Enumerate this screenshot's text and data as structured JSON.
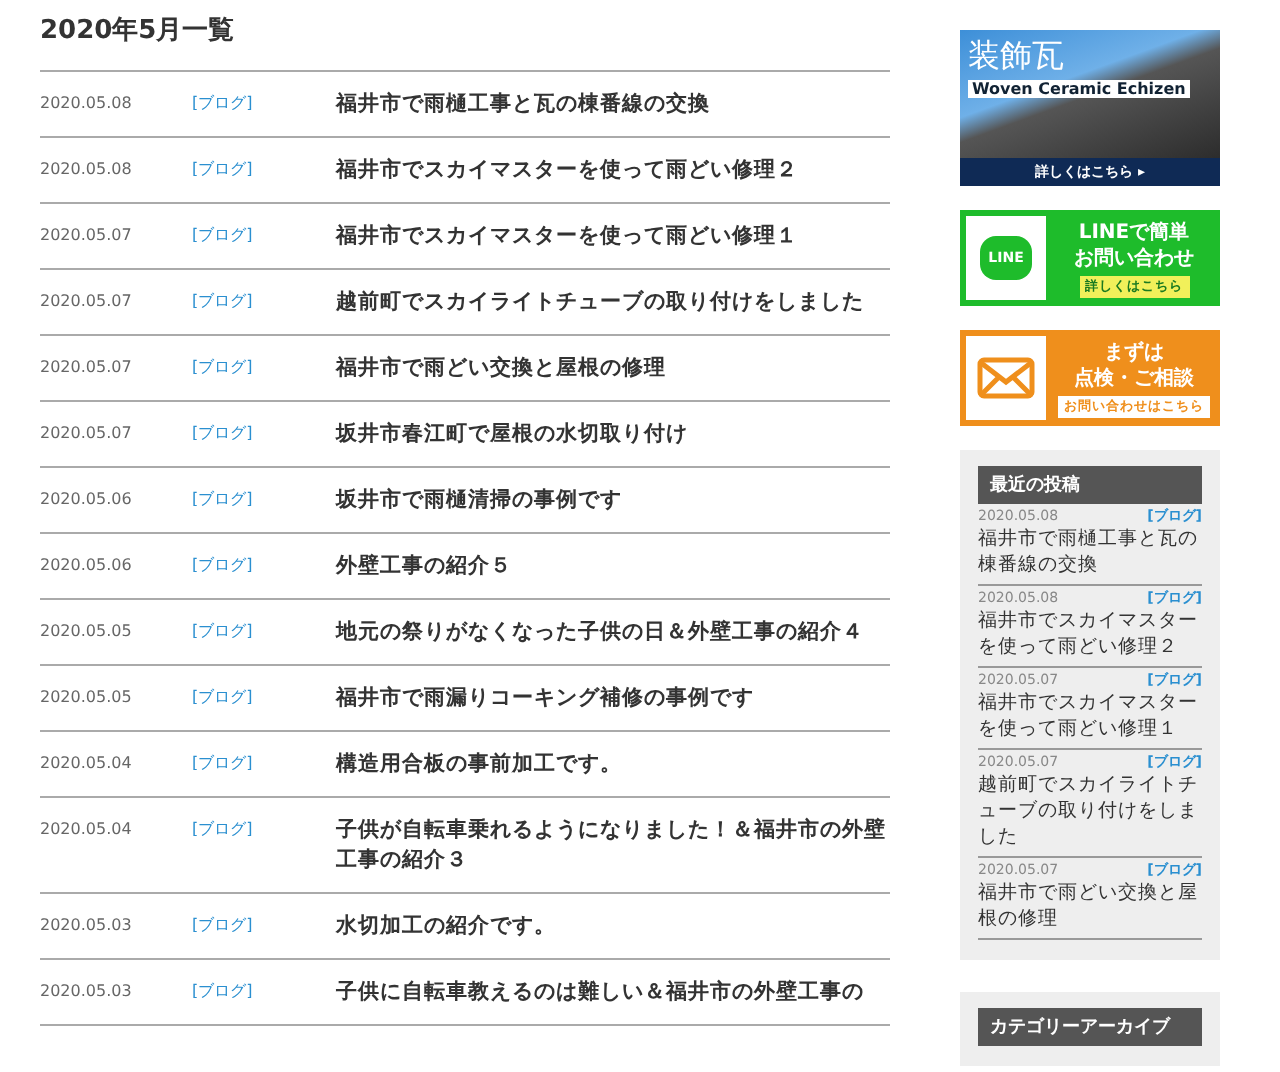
{
  "heading": "2020年5月一覧",
  "posts": [
    {
      "date": "2020.05.08",
      "category": "[ブログ]",
      "title": "福井市で雨樋工事と瓦の棟番線の交換"
    },
    {
      "date": "2020.05.08",
      "category": "[ブログ]",
      "title": "福井市でスカイマスターを使って雨どい修理２"
    },
    {
      "date": "2020.05.07",
      "category": "[ブログ]",
      "title": "福井市でスカイマスターを使って雨どい修理１"
    },
    {
      "date": "2020.05.07",
      "category": "[ブログ]",
      "title": "越前町でスカイライトチューブの取り付けをしました"
    },
    {
      "date": "2020.05.07",
      "category": "[ブログ]",
      "title": "福井市で雨どい交換と屋根の修理"
    },
    {
      "date": "2020.05.07",
      "category": "[ブログ]",
      "title": "坂井市春江町で屋根の水切取り付け"
    },
    {
      "date": "2020.05.06",
      "category": "[ブログ]",
      "title": "坂井市で雨樋清掃の事例です"
    },
    {
      "date": "2020.05.06",
      "category": "[ブログ]",
      "title": "外壁工事の紹介５"
    },
    {
      "date": "2020.05.05",
      "category": "[ブログ]",
      "title": "地元の祭りがなくなった子供の日＆外壁工事の紹介４"
    },
    {
      "date": "2020.05.05",
      "category": "[ブログ]",
      "title": "福井市で雨漏りコーキング補修の事例です"
    },
    {
      "date": "2020.05.04",
      "category": "[ブログ]",
      "title": "構造用合板の事前加工です。"
    },
    {
      "date": "2020.05.04",
      "category": "[ブログ]",
      "title": "子供が自転車乗れるようになりました！＆福井市の外壁工事の紹介３"
    },
    {
      "date": "2020.05.03",
      "category": "[ブログ]",
      "title": "水切加工の紹介です。"
    },
    {
      "date": "2020.05.03",
      "category": "[ブログ]",
      "title": "子供に自転車教えるのは難しい＆福井市の外壁工事の"
    }
  ],
  "sidebar": {
    "tile_banner": {
      "title": "装飾瓦",
      "subtitle": "Woven Ceramic Echizen",
      "link": "詳しくはこちら ▸"
    },
    "line_banner": {
      "icon_text": "LINE",
      "line_1": "LINEで簡単",
      "line_2": "お問い合わせ",
      "link": "詳しくはこちら"
    },
    "mail_banner": {
      "line_1": "まずは",
      "line_2": "点検・ご相談",
      "link": "お問い合わせはこちら"
    },
    "recent_posts": {
      "title": "最近の投稿",
      "items": [
        {
          "date": "2020.05.08",
          "category": "[ブログ]",
          "title": "福井市で雨樋工事と瓦の棟番線の交換"
        },
        {
          "date": "2020.05.08",
          "category": "[ブログ]",
          "title": "福井市でスカイマスターを使って雨どい修理２"
        },
        {
          "date": "2020.05.07",
          "category": "[ブログ]",
          "title": "福井市でスカイマスターを使って雨どい修理１"
        },
        {
          "date": "2020.05.07",
          "category": "[ブログ]",
          "title": "越前町でスカイライトチューブの取り付けをしました"
        },
        {
          "date": "2020.05.07",
          "category": "[ブログ]",
          "title": "福井市で雨どい交換と屋根の修理"
        }
      ]
    },
    "category_archive": {
      "title": "カテゴリーアーカイブ"
    }
  }
}
